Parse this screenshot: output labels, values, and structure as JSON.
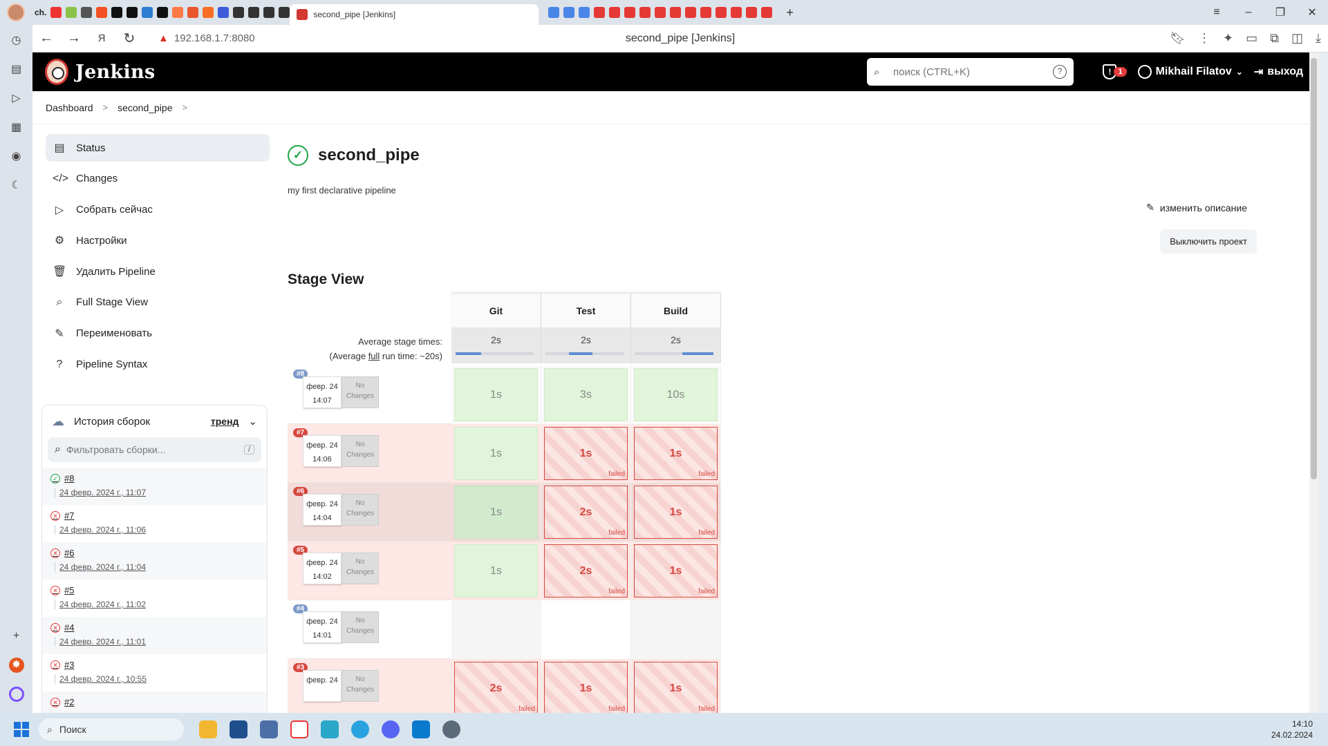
{
  "browser": {
    "url": "192.168.1.7:8080",
    "page_title": "second_pipe [Jenkins]",
    "tab_label": "ch."
  },
  "header": {
    "title": "Jenkins",
    "search_placeholder": "поиск (CTRL+K)",
    "notifications_count": "1",
    "user_name": "Mikhail Filatov",
    "logout_label": "выход"
  },
  "breadcrumbs": [
    "Dashboard",
    "second_pipe"
  ],
  "sidebar": {
    "items": [
      {
        "label": "Status",
        "icon": "status-icon"
      },
      {
        "label": "Changes",
        "icon": "code-icon"
      },
      {
        "label": "Собрать сейчас",
        "icon": "play-icon"
      },
      {
        "label": "Настройки",
        "icon": "gear-icon"
      },
      {
        "label": "Удалить Pipeline",
        "icon": "trash-icon"
      },
      {
        "label": "Full Stage View",
        "icon": "search-icon"
      },
      {
        "label": "Переименовать",
        "icon": "pencil-icon"
      },
      {
        "label": "Pipeline Syntax",
        "icon": "help-icon"
      }
    ]
  },
  "history": {
    "title": "История сборок",
    "trend_label": "тренд",
    "filter_placeholder": "Фильтровать сборки...",
    "filter_shortcut": "/",
    "builds": [
      {
        "num": "#8",
        "date": "24 февр. 2024 г., 11:07",
        "status": "ok"
      },
      {
        "num": "#7",
        "date": "24 февр. 2024 г., 11:06",
        "status": "fail"
      },
      {
        "num": "#6",
        "date": "24 февр. 2024 г., 11:04",
        "status": "fail"
      },
      {
        "num": "#5",
        "date": "24 февр. 2024 г., 11:02",
        "status": "fail"
      },
      {
        "num": "#4",
        "date": "24 февр. 2024 г., 11:01",
        "status": "fail"
      },
      {
        "num": "#3",
        "date": "24 февр. 2024 г., 10:55",
        "status": "fail"
      },
      {
        "num": "#2",
        "date": "",
        "status": "fail"
      }
    ]
  },
  "main": {
    "project_name": "second_pipe",
    "description": "my first declarative pipeline",
    "edit_description": "изменить описание",
    "disable_button": "Выключить проект",
    "stage_view_title": "Stage View"
  },
  "stage_view": {
    "stages": [
      "Git",
      "Test",
      "Build"
    ],
    "avg_label_1": "Average stage times:",
    "avg_label_2a": "(Average ",
    "avg_label_2b": "full",
    "avg_label_2c": " run time: ~20s)",
    "avg_times": [
      "2s",
      "2s",
      "2s"
    ],
    "avg_bars": [
      {
        "from": 0,
        "to": 0.33
      },
      {
        "from": 0.3,
        "to": 0.6
      },
      {
        "from": 0.6,
        "to": 1.0
      }
    ],
    "no_changes": [
      "No",
      "Changes"
    ],
    "failed_label": "failed",
    "rows": [
      {
        "num": "#8",
        "badge": "blue",
        "style": "",
        "date": "февр. 24",
        "time": "14:07",
        "cells": [
          {
            "t": "1s",
            "s": "ok"
          },
          {
            "t": "3s",
            "s": "ok"
          },
          {
            "t": "10s",
            "s": "ok"
          }
        ]
      },
      {
        "num": "#7",
        "badge": "red",
        "style": "fail",
        "date": "февр. 24",
        "time": "14:06",
        "cells": [
          {
            "t": "1s",
            "s": "ok"
          },
          {
            "t": "1s",
            "s": "failed"
          },
          {
            "t": "1s",
            "s": "failed"
          }
        ]
      },
      {
        "num": "#6",
        "badge": "red",
        "style": "dark",
        "date": "февр. 24",
        "time": "14:04",
        "cells": [
          {
            "t": "1s",
            "s": "okdark"
          },
          {
            "t": "2s",
            "s": "failed"
          },
          {
            "t": "1s",
            "s": "failed"
          }
        ]
      },
      {
        "num": "#5",
        "badge": "red",
        "style": "fail",
        "date": "февр. 24",
        "time": "14:02",
        "cells": [
          {
            "t": "1s",
            "s": "ok"
          },
          {
            "t": "2s",
            "s": "failed"
          },
          {
            "t": "1s",
            "s": "failed"
          }
        ]
      },
      {
        "num": "#4",
        "badge": "blue",
        "style": "empty",
        "date": "февр. 24",
        "time": "14:01",
        "cells": [
          {
            "t": "",
            "s": "none"
          },
          {
            "t": "",
            "s": "none"
          },
          {
            "t": "",
            "s": "none"
          }
        ]
      },
      {
        "num": "#3",
        "badge": "red",
        "style": "fail",
        "date": "февр. 24",
        "time": "",
        "cells": [
          {
            "t": "2s",
            "s": "failed"
          },
          {
            "t": "1s",
            "s": "failed"
          },
          {
            "t": "1s",
            "s": "failed"
          }
        ]
      }
    ]
  },
  "taskbar": {
    "search_placeholder": "Поиск",
    "time": "14:10",
    "date": "24.02.2024"
  }
}
